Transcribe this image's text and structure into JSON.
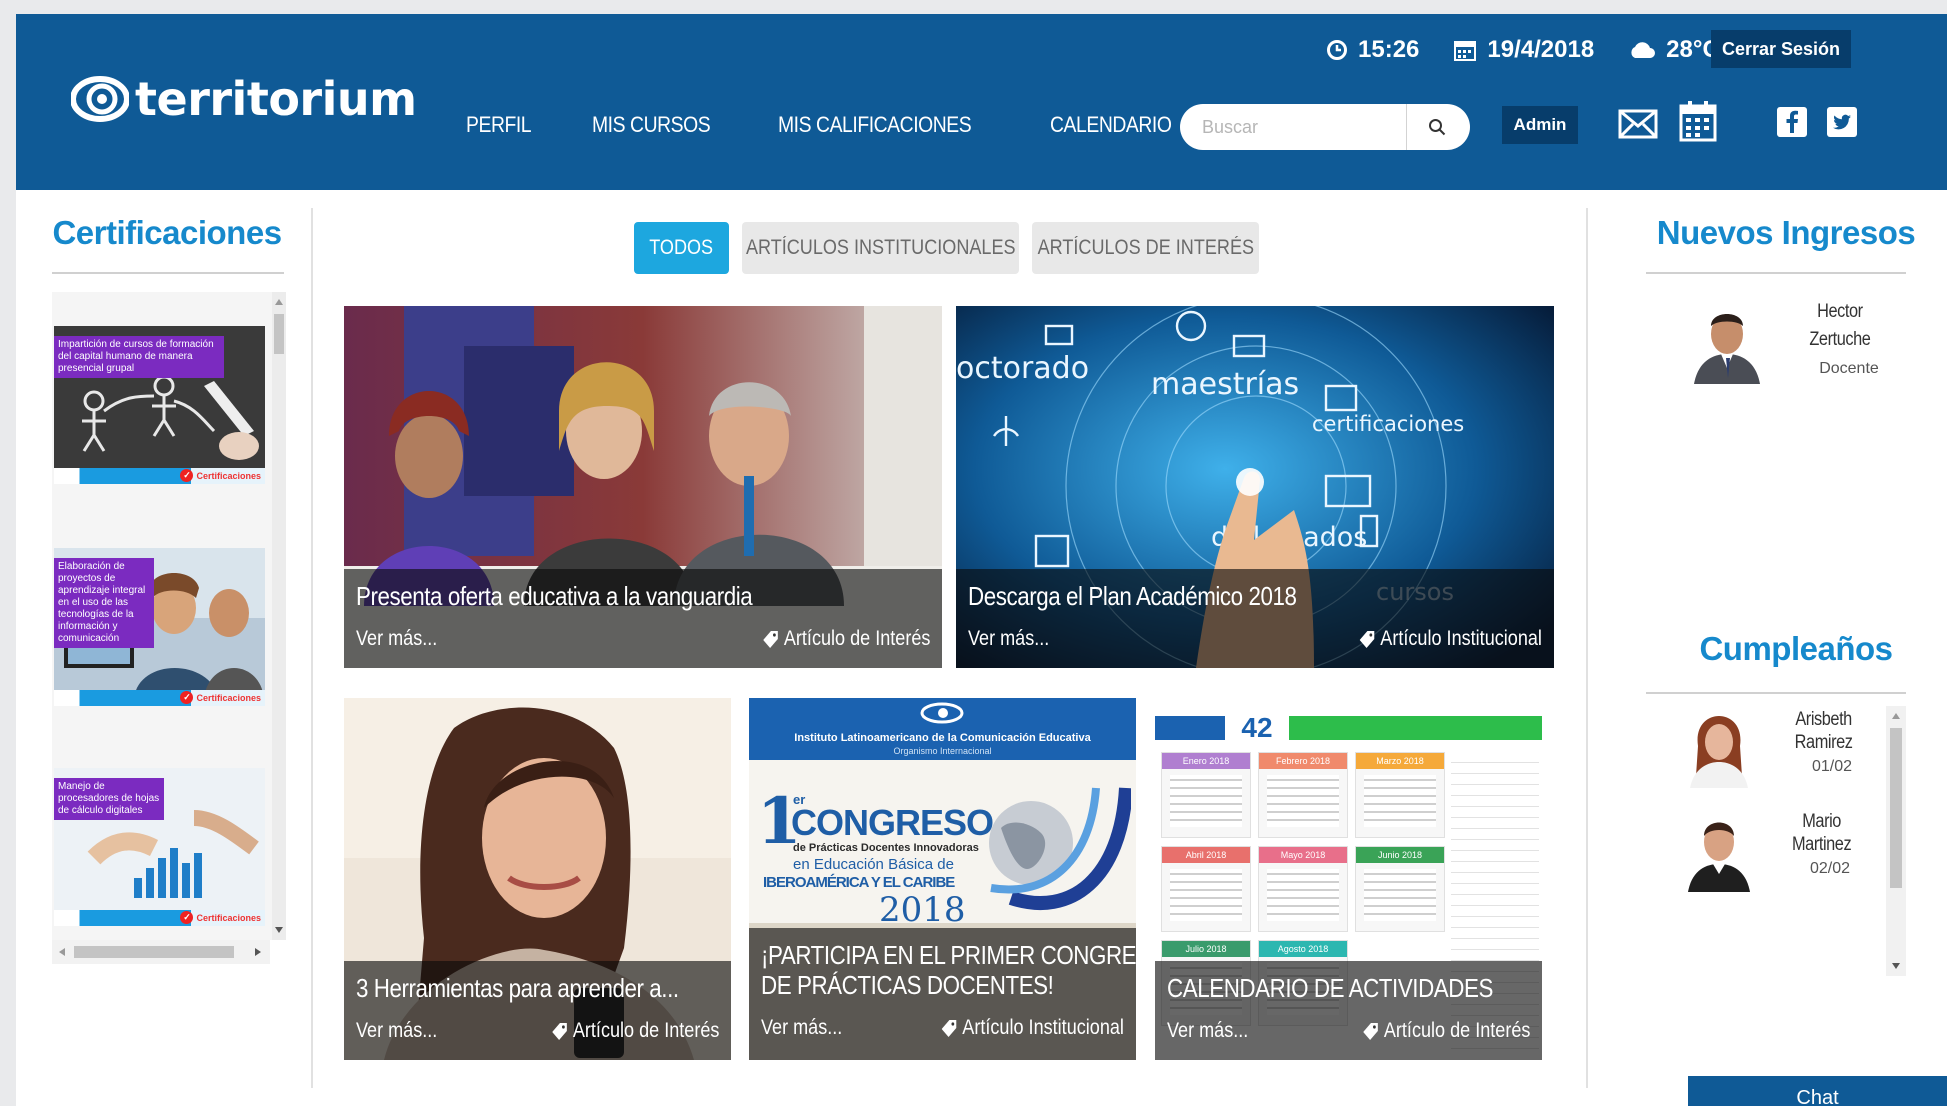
{
  "header": {
    "brand": "territorium",
    "nav": [
      "PERFIL",
      "MIS CURSOS",
      "MIS CALIFICACIONES",
      "CALENDARIO"
    ],
    "time": "15:26",
    "date": "19/4/2018",
    "weather": "28°C",
    "logout_label": "Cerrar Sesión",
    "search_placeholder": "Buscar",
    "admin_label": "Admin",
    "icons": [
      "clock-icon",
      "calendar-icon",
      "cloud-icon",
      "search-icon",
      "mail-icon",
      "calendar-grid-icon",
      "facebook-icon",
      "twitter-icon"
    ]
  },
  "certifications": {
    "title": "Certificaciones",
    "items": [
      {
        "caption": "Impartición de cursos de formación del capital humano de manera presencial grupal",
        "badge": "Certificaciones"
      },
      {
        "caption": "Elaboración de proyectos de aprendizaje integral en el uso de las tecnologías de la información y comunicación",
        "badge": "Certificaciones"
      },
      {
        "caption": "Manejo de procesadores de hojas de cálculo digitales",
        "badge": "Certificaciones"
      }
    ]
  },
  "tabs": [
    "TODOS",
    "ARTÍCULOS INSTITUCIONALES",
    "ARTÍCULOS DE INTERÉS"
  ],
  "articles": [
    {
      "title": "Presenta oferta educativa a la vanguardia",
      "more": "Ver más...",
      "category": "Artículo de Interés"
    },
    {
      "title": "Descarga el Plan Académico 2018",
      "more": "Ver más...",
      "category": "Artículo Institucional",
      "image_words": [
        "octorado",
        "maestrías",
        "certificaciones",
        "diplomados",
        "cursos"
      ]
    },
    {
      "title": "3 Herramientas para aprender a...",
      "more": "Ver más...",
      "category": "Artículo de Interés"
    },
    {
      "title": "¡PARTICIPA EN EL PRIMER CONGRESO DE PRÁCTICAS DOCENTES!",
      "title_line1": "¡PARTICIPA EN EL PRIMER CONGRESO",
      "title_line2": "DE PRÁCTICAS DOCENTES!",
      "more": "Ver más...",
      "category": "Artículo Institucional",
      "poster": {
        "org": "Instituto Latinoamericano de la Comunicación Educativa",
        "org_sub": "Organismo Internacional",
        "headline": "CONGRESO",
        "sub1": "de Prácticas Docentes Innovadoras",
        "sub2": "en Educación Básica de",
        "sub3": "IBEROAMÉRICA Y EL CARIBE",
        "year": "2018"
      }
    },
    {
      "title": "CALENDARIO DE ACTIVIDADES",
      "more": "Ver más...",
      "category": "Artículo de Interés",
      "calendar": {
        "number": "42",
        "months": [
          "Enero 2018",
          "Febrero 2018",
          "Marzo 2018",
          "Abril 2018",
          "Mayo 2018",
          "Junio 2018",
          "Julio 2018",
          "Agosto 2018"
        ]
      }
    }
  ],
  "new_members": {
    "title": "Nuevos Ingresos",
    "people": [
      {
        "first": "Hector",
        "last": "Zertuche",
        "role": "Docente"
      }
    ]
  },
  "birthdays": {
    "title": "Cumpleaños",
    "people": [
      {
        "first": "Arisbeth",
        "last": "Ramirez",
        "date": "01/02"
      },
      {
        "first": "Mario",
        "last": "Martinez",
        "date": "02/02"
      }
    ]
  },
  "chat_label": "Chat",
  "colors": {
    "header": "#0f5a96",
    "accent": "#1689cc",
    "tab_active": "#1da7df",
    "button_dark": "#073d6b"
  }
}
